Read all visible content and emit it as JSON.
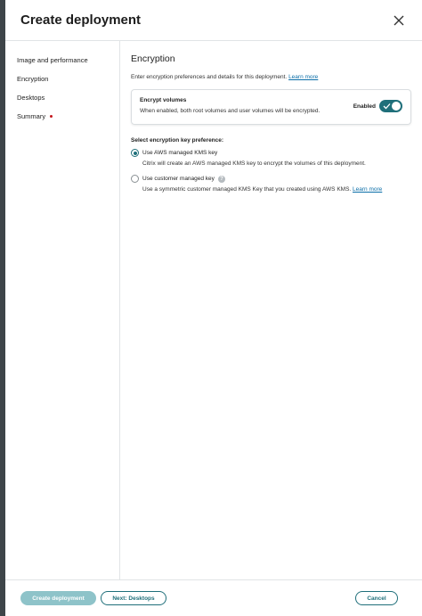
{
  "modal": {
    "title": "Create deployment"
  },
  "sidebar": {
    "items": [
      {
        "label": "Image and performance"
      },
      {
        "label": "Encryption"
      },
      {
        "label": "Desktops"
      },
      {
        "label": "Summary"
      }
    ]
  },
  "content": {
    "title": "Encryption",
    "description": "Enter encryption preferences and details for this deployment.",
    "learn_more": "Learn more",
    "card": {
      "title": "Encrypt volumes",
      "description": "When enabled, both root volumes and user volumes will be encrypted.",
      "toggle_label": "Enabled",
      "toggle_on": true
    },
    "key_pref_label": "Select encryption key preference:",
    "options": [
      {
        "label": "Use AWS managed KMS key",
        "description": "Citrix will create an AWS managed KMS key to encrypt the volumes of this deployment.",
        "checked": true
      },
      {
        "label": "Use customer managed key",
        "description": "Use a symmetric customer managed KMS Key that you created using AWS KMS.",
        "learn_more": "Learn more",
        "help_icon": "?",
        "checked": false
      }
    ]
  },
  "footer": {
    "create_label": "Create deployment",
    "next_label": "Next: Desktops",
    "cancel_label": "Cancel"
  },
  "colors": {
    "accent": "#1f6f7a",
    "disabled_primary": "#8ec3c9",
    "link": "#0b6ea8",
    "required_dot": "#c4161c"
  },
  "icons": {
    "close": "close-icon",
    "help": "help-icon",
    "check": "check-icon"
  }
}
